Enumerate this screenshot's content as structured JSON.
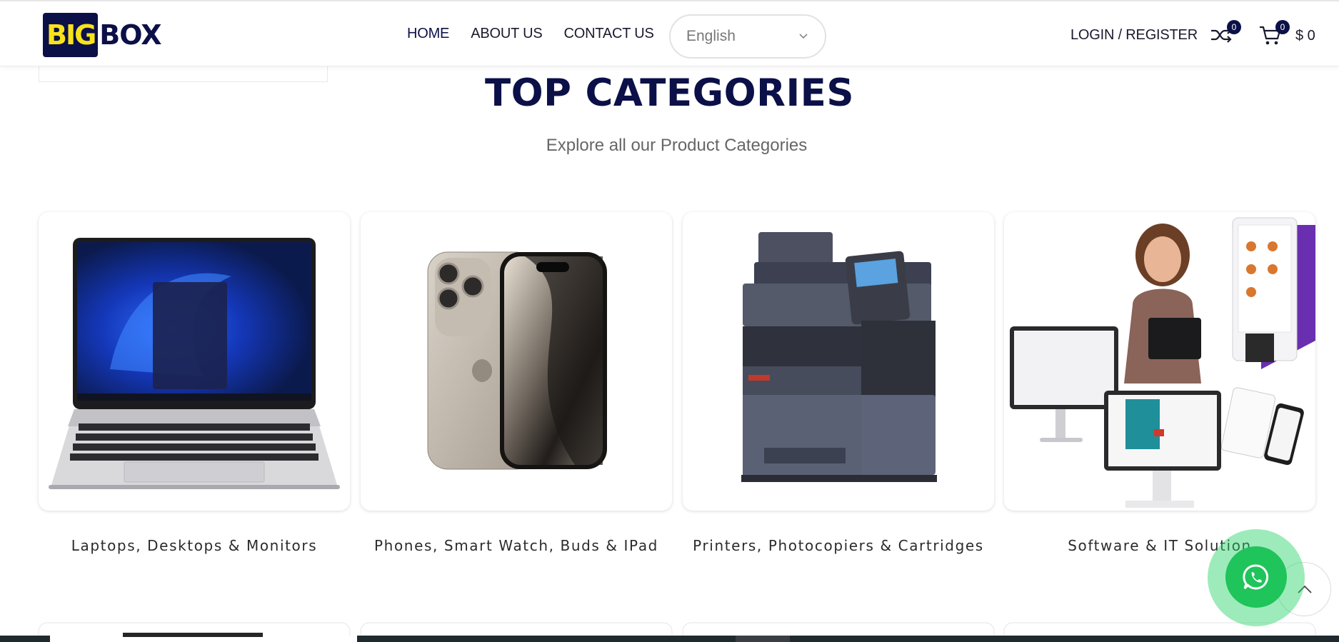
{
  "header": {
    "logo": {
      "part1": "BIG",
      "part2": "BOX"
    },
    "nav": [
      {
        "label": "HOME"
      },
      {
        "label": "ABOUT US"
      },
      {
        "label": "CONTACT US"
      }
    ],
    "language": {
      "selected": "English"
    },
    "login_label": "LOGIN / REGISTER",
    "compare_count": "0",
    "cart_count": "0",
    "cart_total": "$ 0"
  },
  "section": {
    "title": "TOP CATEGORIES",
    "subtitle": "Explore all our Product Categories"
  },
  "categories": [
    {
      "label": "Laptops, Desktops & Monitors",
      "image": "laptop"
    },
    {
      "label": "Phones, Smart Watch, Buds & IPad",
      "image": "phone"
    },
    {
      "label": "Printers, Photocopiers & Cartridges",
      "image": "printer"
    },
    {
      "label": "Software & IT Solution",
      "image": "pos-software"
    }
  ],
  "colors": {
    "brand_navy": "#0c1048",
    "brand_yellow": "#f7e31b",
    "whatsapp_green": "#1fc45a"
  },
  "floating": {
    "whatsapp_icon": "whatsapp-icon",
    "scroll_top_icon": "chevron-up-icon"
  }
}
